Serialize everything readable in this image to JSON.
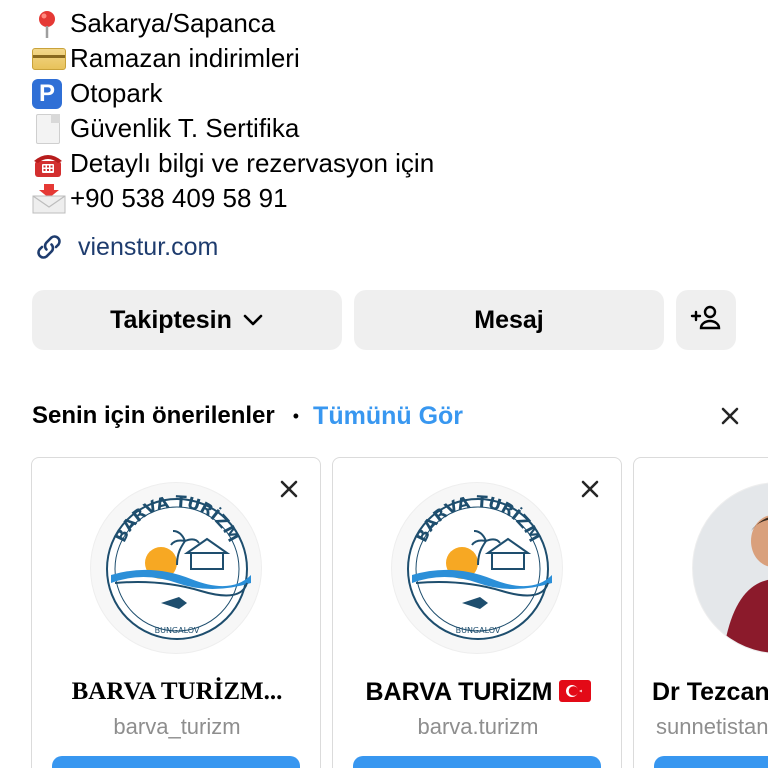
{
  "bio": {
    "lines": [
      {
        "icon": "pin-icon",
        "text": "Sakarya/Sapanca"
      },
      {
        "icon": "credit-card-icon",
        "text": "Ramazan indirimleri"
      },
      {
        "icon": "parking-icon",
        "text": "Otopark"
      },
      {
        "icon": "document-icon",
        "text": "Güvenlik T. Sertifika"
      },
      {
        "icon": "telephone-icon",
        "text": " Detaylı bilgi ve rezervasyon için"
      },
      {
        "icon": "incoming-envelope-icon",
        "text": " +90 538 409 58 91"
      }
    ],
    "parking_glyph": "P",
    "link": "vienstur.com"
  },
  "actions": {
    "follow_label": "Takiptesin",
    "message_label": "Mesaj"
  },
  "suggestions": {
    "title": "Senin için önerilenler",
    "separator": "•",
    "see_all": "Tümünü Gör",
    "cards": [
      {
        "name": "BARVA TURİZM...",
        "username": "barva_turizm",
        "logo_text": "BARVA TURİZM",
        "logo_sub": "BUNGALOV"
      },
      {
        "name": "BARVA TURİZM",
        "username": "barva.turizm",
        "logo_text": "BARVA TURİZM",
        "logo_sub": "BUNGALOV",
        "flag": "turkey-flag-icon"
      },
      {
        "name": "Dr Tezcan",
        "username": "sunnetistan"
      }
    ]
  },
  "colors": {
    "accent": "#3897f0",
    "link": "#1e3c6e",
    "button_bg": "#efefef",
    "muted": "#8e8e8e"
  }
}
